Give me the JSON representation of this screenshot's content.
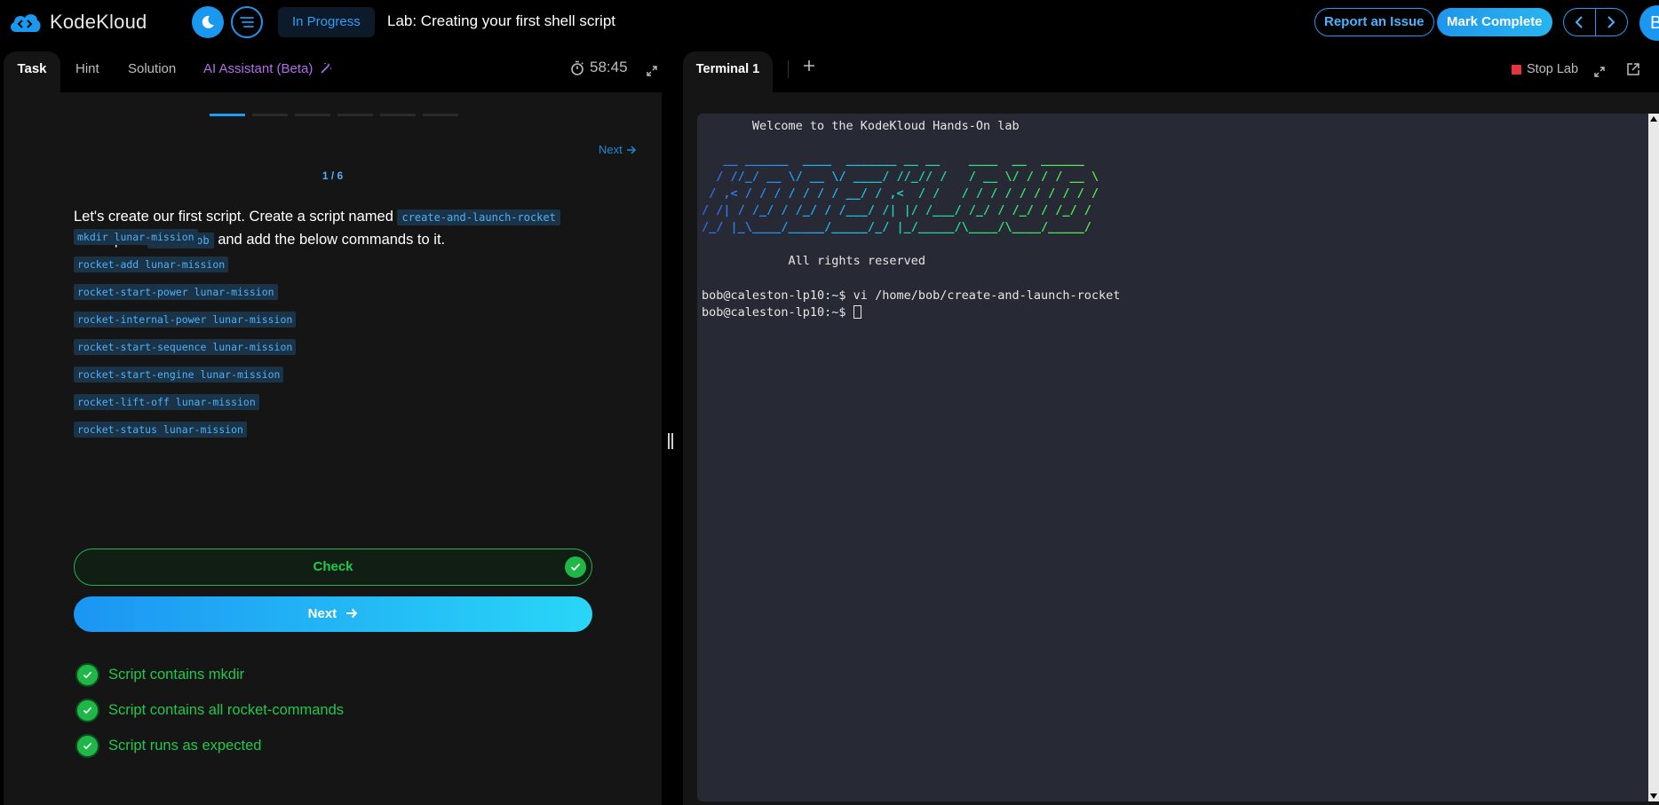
{
  "brand": {
    "name": "KodeKloud"
  },
  "header": {
    "status": "In Progress",
    "title": "Lab: Creating your first shell script",
    "report_issue": "Report an Issue",
    "mark_complete": "Mark Complete",
    "avatar_initial": "B"
  },
  "left_tabs": [
    "Task",
    "Hint",
    "Solution",
    "AI Assistant (Beta)"
  ],
  "timer": "58:45",
  "progress": {
    "total_steps": 6,
    "current_step": 1
  },
  "task": {
    "next_link": "Next",
    "step_label": "1 / 6",
    "text_part1": "Let's create our first script. Create a script named",
    "script_name": "create-and-launch-rocket",
    "text_part2": "at the path",
    "path": "/home/bob",
    "text_part3": "and add the below commands to it.",
    "commands": [
      "mkdir lunar-mission",
      "rocket-add lunar-mission",
      "rocket-start-power lunar-mission",
      "rocket-internal-power lunar-mission",
      "rocket-start-sequence lunar-mission",
      "rocket-start-engine lunar-mission",
      "rocket-lift-off lunar-mission",
      "rocket-status lunar-mission"
    ],
    "check_label": "Check",
    "next_label": "Next"
  },
  "results": [
    "Script contains mkdir",
    "Script contains all rocket-commands",
    "Script runs as expected"
  ],
  "terminal": {
    "tab_label": "Terminal 1",
    "stop_label": "Stop Lab",
    "welcome": "       Welcome to the KodeKloud Hands-On lab",
    "art": [
      "   __ ______  ____  _______ __ __    ____  __  ______",
      "  / //_/ __ \\/ __ \\/ ____/ //_// /   / __ \\/ / / / __ \\",
      " / ,< / / / / / / / __/ / ,<  / /   / / / / / / / / / /",
      "/ /| / /_/ / /_/ / /___/ /| |/ /___/ /_/ / /_/ / /_/ /",
      "/_/ |_\\____/_____/_____/_/ |_/_____/\\____/\\____/_____/"
    ],
    "rights": "            All rights reserved",
    "line1": "bob@caleston-lp10:~$ vi /home/bob/create-and-launch-rocket",
    "line2": "bob@caleston-lp10:~$ ",
    "colors": {
      "art_gradient": [
        "#2f6bf0",
        "#1fb7f2",
        "#22e28a",
        "#58f04a"
      ]
    }
  },
  "icons": {
    "moon": "moon-icon",
    "menu": "menu-lines-icon",
    "chevron_left": "chevron-left-icon",
    "chevron_right": "chevron-right-icon",
    "timer": "stopwatch-icon",
    "expand": "expand-icon",
    "plus": "plus-icon",
    "popout": "external-link-icon",
    "wand": "magic-wand-icon",
    "check": "check-icon"
  },
  "colors": {
    "accent": "#1e9cf5",
    "success": "#1fb848",
    "ai_purple": "#b26ee8",
    "stop_red": "#e8343c"
  }
}
